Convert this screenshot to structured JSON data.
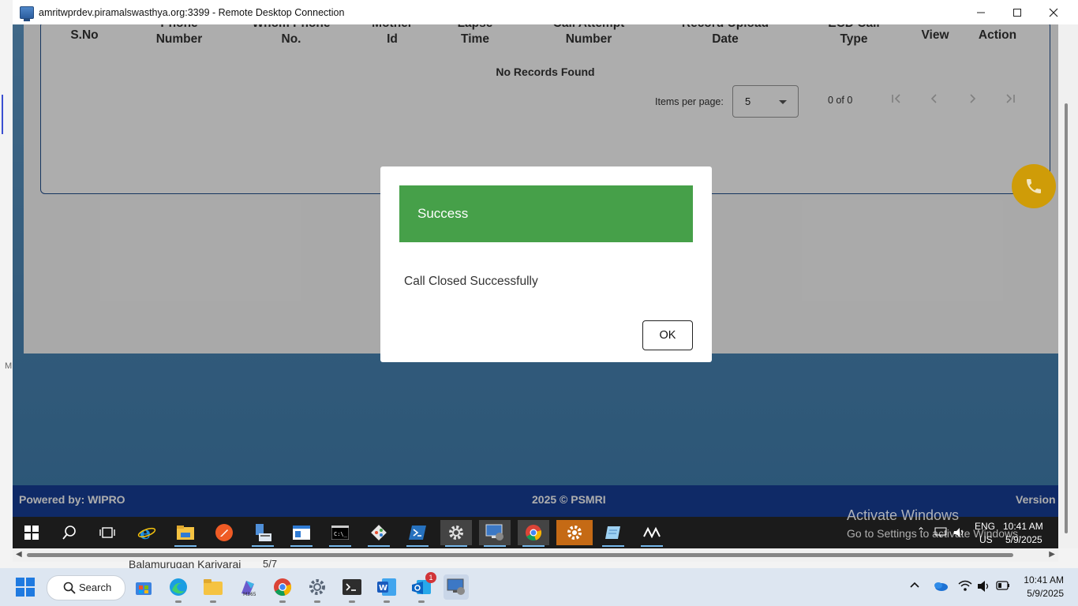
{
  "window": {
    "title": "amritwprdev.piramalswasthya.org:3399 - Remote Desktop Connection",
    "min_icon": "minimize-icon",
    "max_icon": "maximize-icon",
    "close_icon": "close-icon"
  },
  "host_background": {
    "left_letter": "M",
    "contact_name": "Balamurugan Karivarai",
    "contact_count": "5/7"
  },
  "table": {
    "headers": [
      {
        "line1": "S.No",
        "line2": ""
      },
      {
        "line1": "Phone",
        "line2": "Number"
      },
      {
        "line1": "Whom Phone",
        "line2": "No."
      },
      {
        "line1": "Mother",
        "line2": "Id"
      },
      {
        "line1": "Lapse",
        "line2": "Time"
      },
      {
        "line1": "Call Attempt",
        "line2": "Number"
      },
      {
        "line1": "Record Upload",
        "line2": "Date"
      },
      {
        "line1": "ECD Call",
        "line2": "Type"
      },
      {
        "line1": "View",
        "line2": ""
      },
      {
        "line1": "Action",
        "line2": ""
      }
    ],
    "empty_message": "No Records Found"
  },
  "paginator": {
    "items_per_page_label": "Items per page:",
    "page_size": "5",
    "range_label": "0 of 0",
    "first_icon": "first-page-icon",
    "prev_icon": "previous-page-icon",
    "next_icon": "next-page-icon",
    "last_icon": "last-page-icon"
  },
  "dialog": {
    "title": "Success",
    "message": "Call Closed Successfully",
    "ok_label": "OK"
  },
  "footer": {
    "left": "Powered by: WIPRO",
    "center": "2025 © PSMRI",
    "right": "Version"
  },
  "call_button_icon": "phone-icon",
  "remote_taskbar": {
    "icons": [
      "windows-start-icon",
      "search-icon",
      "task-view-icon",
      "internet-explorer-icon",
      "file-explorer-icon",
      "postman-icon",
      "device-manager-icon",
      "app-window-icon",
      "command-prompt-icon",
      "git-icon",
      "powershell-icon",
      "settings-icon",
      "remote-desktop-icon",
      "chrome-icon",
      "services-gear-icon",
      "notepad-icon",
      "network-icon"
    ],
    "language": "ENG",
    "region": "US",
    "time": "10:41 AM",
    "date": "5/9/2025",
    "watermark_title": "Activate Windows",
    "watermark_sub": "Go to Settings to activate Windows."
  },
  "host_taskbar": {
    "search_label": "Search",
    "icons": [
      "windows-start-icon",
      "microsoft-store-icon",
      "edge-icon",
      "file-explorer-icon",
      "m365-icon",
      "chrome-icon",
      "settings-icon",
      "terminal-icon",
      "word-icon",
      "outlook-icon",
      "remote-desktop-icon"
    ],
    "outlook_badge": "1",
    "time": "10:41 AM",
    "date": "5/9/2025"
  },
  "colors": {
    "success_header": "#46a049",
    "footer_bg": "#173f99",
    "fab": "#cf9c08"
  }
}
